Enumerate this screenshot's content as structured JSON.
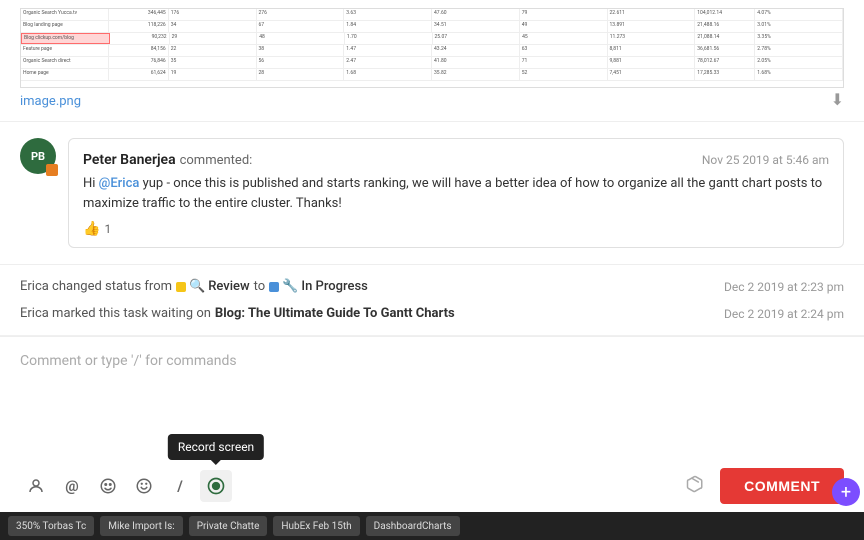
{
  "image": {
    "filename": "image.png",
    "download_label": "⬇"
  },
  "comment": {
    "avatar_initials": "PB",
    "author": "Peter Banerjea",
    "action": "commented:",
    "timestamp": "Nov 25 2019 at 5:46 am",
    "mention": "@Erica",
    "text_before": "Hi ",
    "text_after": " yup - once this is published and starts ranking, we will have a better idea of how to organize all the gantt chart posts to maximize traffic to the entire cluster. Thanks!",
    "like_count": "1"
  },
  "activity": [
    {
      "prefix": "Erica changed status from",
      "from_status": "Review",
      "to_word": "to",
      "to_status": "In Progress",
      "timestamp": "Dec 2 2019 at 2:23 pm"
    },
    {
      "prefix": "Erica marked this task waiting on",
      "task_link": "Blog: The Ultimate Guide To Gantt Charts",
      "timestamp": "Dec 2 2019 at 2:24 pm"
    }
  ],
  "comment_input": {
    "placeholder": "Comment or type '/' for commands"
  },
  "toolbar": {
    "icons": [
      {
        "name": "person-icon",
        "symbol": "😊",
        "label": "Assignee"
      },
      {
        "name": "at-icon",
        "symbol": "@",
        "label": "Mention"
      },
      {
        "name": "emoji-icon",
        "symbol": "🙂",
        "label": "Emoji"
      },
      {
        "name": "smiley-icon",
        "symbol": "😄",
        "label": "Reaction"
      },
      {
        "name": "slash-icon",
        "symbol": "/",
        "label": "Commands"
      },
      {
        "name": "record-icon",
        "symbol": "⏺",
        "label": "Record screen",
        "active": true
      }
    ],
    "record_tooltip": "Record screen",
    "comment_button": "COMMENT"
  },
  "taskbar": {
    "items": [
      "350% Torbas Tc",
      "Mike Import Is:",
      "Private Chatte",
      "HubEx Feb 15th",
      "DashboardCharts"
    ]
  },
  "fab": {
    "symbol": "+"
  }
}
